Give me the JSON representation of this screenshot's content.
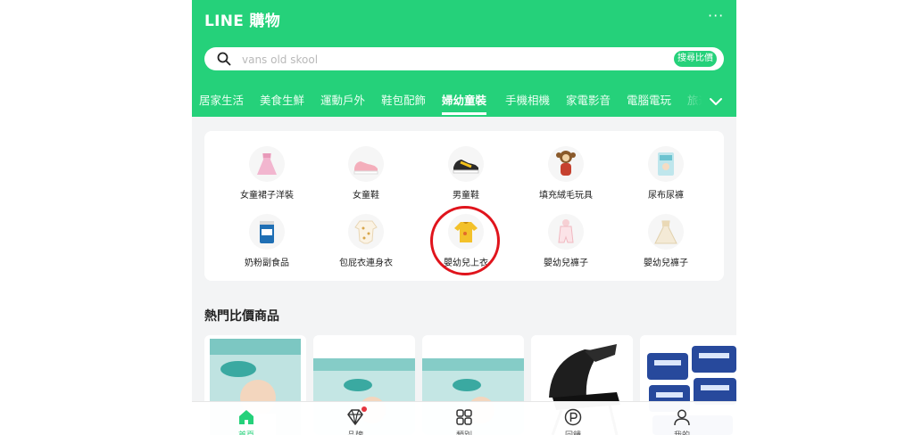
{
  "header": {
    "logo": "LINE 購物",
    "more": "···",
    "accent": "#25d17a"
  },
  "search": {
    "placeholder": "vans old skool",
    "button_label": "搜尋比價"
  },
  "tabs": [
    {
      "label": "居家生活"
    },
    {
      "label": "美食生鮮"
    },
    {
      "label": "運動戶外"
    },
    {
      "label": "鞋包配飾"
    },
    {
      "label": "婦幼童裝",
      "active": true
    },
    {
      "label": "手機相機"
    },
    {
      "label": "家電影音"
    },
    {
      "label": "電腦電玩"
    },
    {
      "label": "旅遊"
    }
  ],
  "categories": [
    {
      "label": "女童裙子洋裝",
      "icon": "pink-dress-icon"
    },
    {
      "label": "女童鞋",
      "icon": "pink-shoe-icon"
    },
    {
      "label": "男童鞋",
      "icon": "sneaker-icon"
    },
    {
      "label": "填充絨毛玩具",
      "icon": "plush-monkey-icon"
    },
    {
      "label": "尿布尿褲",
      "icon": "diaper-pack-icon"
    },
    {
      "label": "奶粉副食品",
      "icon": "formula-can-icon"
    },
    {
      "label": "包屁衣連身衣",
      "icon": "onesie-icon"
    },
    {
      "label": "嬰幼兒上衣",
      "icon": "yellow-top-icon",
      "highlighted": true
    },
    {
      "label": "嬰幼兒褲子",
      "icon": "baby-romper-icon"
    },
    {
      "label": "嬰幼兒褲子",
      "icon": "lace-dress-icon"
    }
  ],
  "hot": {
    "title": "熱門比價商品",
    "products": [
      {
        "icon": "pampers-box-icon"
      },
      {
        "icon": "pampers-box-icon"
      },
      {
        "icon": "pampers-box-icon"
      },
      {
        "icon": "stroller-icon"
      },
      {
        "icon": "wipes-pack-icon"
      }
    ]
  },
  "bottom_nav": [
    {
      "label": "首頁",
      "icon": "home-icon",
      "active": true
    },
    {
      "label": "品牌",
      "icon": "diamond-icon",
      "badge": true
    },
    {
      "label": "類別",
      "icon": "grid-icon"
    },
    {
      "label": "回饋",
      "icon": "points-icon"
    },
    {
      "label": "我的",
      "icon": "user-icon"
    }
  ],
  "colors": {
    "accent": "#25d17a",
    "highlight": "#e0141c",
    "background": "#f3f4f5"
  }
}
